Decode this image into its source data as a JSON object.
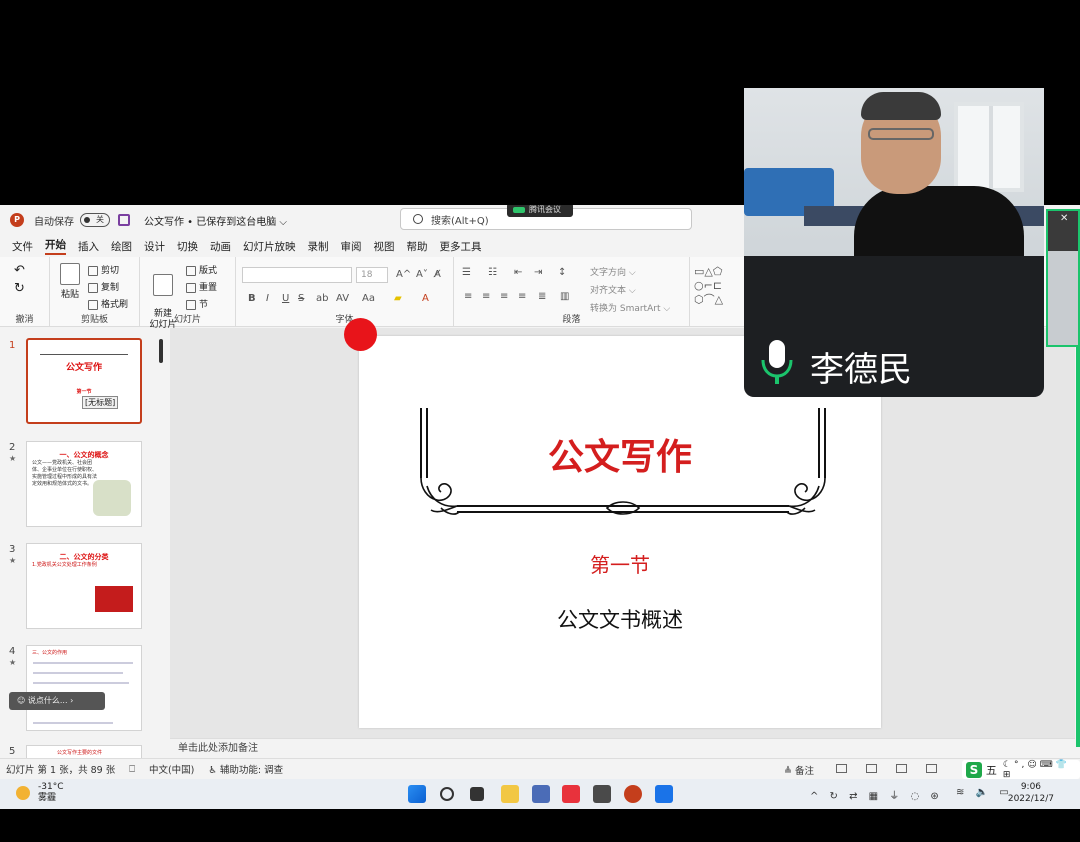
{
  "titlebar": {
    "autosave_label": "自动保存",
    "toggle_state": "关",
    "doc_title": "公文写作 • 已保存到这台电脑 ⌵",
    "search_placeholder": "搜索(Alt+Q)",
    "meeting_label": "腾讯会议"
  },
  "menu": [
    "文件",
    "开始",
    "插入",
    "绘图",
    "设计",
    "切换",
    "动画",
    "幻灯片放映",
    "录制",
    "审阅",
    "视图",
    "帮助",
    "更多工具"
  ],
  "menu_active": "开始",
  "ribbon": {
    "undo_label": "撤消",
    "paste_label": "粘贴",
    "cut_label": "剪切",
    "copy_label": "复制",
    "format_painter_label": "格式刷",
    "clipboard_label": "剪贴板",
    "new_slide_label": "新建\n幻灯片",
    "layout_label": "版式",
    "reset_label": "重置",
    "section_label": "节",
    "slides_group_label": "幻灯片",
    "font_group_label": "字体",
    "font_size": "18",
    "paragraph_group_label": "段落",
    "text_direction_label": "文字方向",
    "align_text_label": "对齐文本",
    "smartart_label": "转换为 SmartArt"
  },
  "thumbnails": [
    {
      "num": "1",
      "title": "公文写作",
      "sub": "第一节",
      "tooltip": "[无标题]"
    },
    {
      "num": "2",
      "title": "一、公文的概念",
      "body": "公文——党政机关、社会团体、企事业单位在行使职权、实施管理过程中形成的具有法定效用和规范体式的文书。"
    },
    {
      "num": "3",
      "title": "二、公文的分类",
      "body": "1.党政机关公文处理工作条例"
    },
    {
      "num": "4",
      "title": "三、公文的作用",
      "body": ""
    },
    {
      "num": "5",
      "title": "公文写作主要的文件",
      "body": ""
    }
  ],
  "float_bar": "说点什么...",
  "slide": {
    "title": "公文写作",
    "section": "第一节",
    "subtitle": "公文文书概述"
  },
  "notes_placeholder": "单击此处添加备注",
  "status": {
    "slide_count": "幻灯片 第 1 张，共 89 张",
    "language": "中文(中国)",
    "accessibility": "辅助功能: 调查",
    "notes_btn": "备注"
  },
  "ime": {
    "logo": "S",
    "mode": "五"
  },
  "taskbar": {
    "temp": "-31°C",
    "weather": "雾霾",
    "time": "9:06",
    "date": "2022/12/7"
  },
  "video": {
    "speaker_name": "李德民"
  },
  "colors": {
    "accent": "#c43e1c",
    "slide_red": "#d41e1e",
    "meeting_green": "#1bc46c"
  }
}
